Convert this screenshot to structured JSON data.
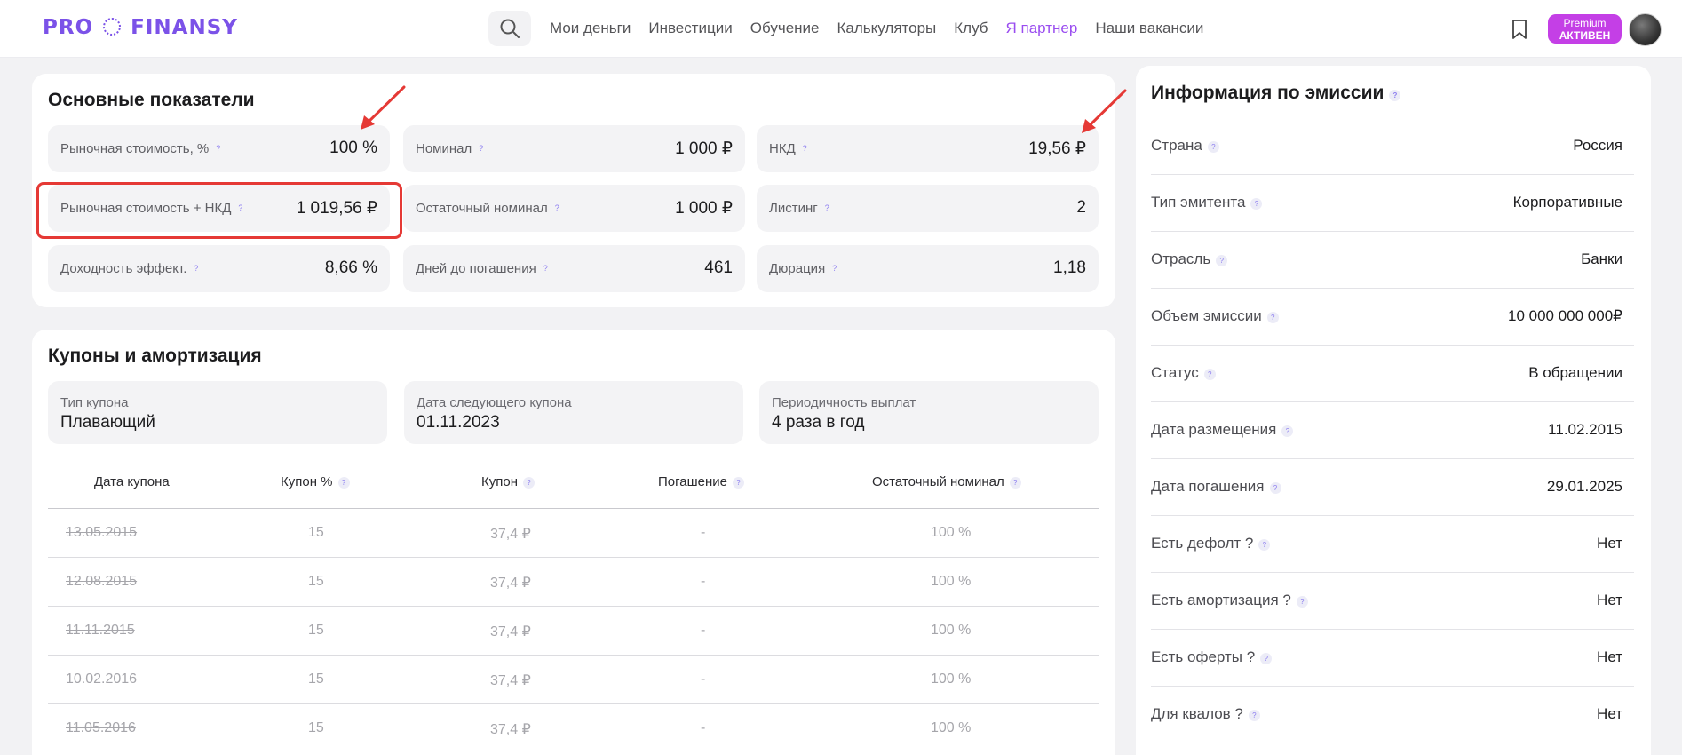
{
  "header": {
    "logo_left": "PRO",
    "logo_right": "FINANSY",
    "nav": [
      "Мои деньги",
      "Инвестиции",
      "Обучение",
      "Калькуляторы",
      "Клуб",
      "Я партнер",
      "Наши вакансии"
    ],
    "premium_line1": "Premium",
    "premium_line2": "АКТИВЕН"
  },
  "icons": {
    "search": "search-icon",
    "bookmark": "bookmark-icon",
    "help": "question-icon"
  },
  "colors": {
    "accent": "#7b52e8",
    "premium": "#c43fe6",
    "highlight": "#e53935",
    "partner": "#9a4df0"
  },
  "main_metrics": {
    "title": "Основные показатели",
    "help": "?",
    "items": [
      {
        "label": "Рыночная стоимость, %",
        "value": "100 %"
      },
      {
        "label": "Номинал",
        "value": "1 000 ₽"
      },
      {
        "label": "НКД",
        "value": "19,56 ₽"
      },
      {
        "label": "Рыночная стоимость + НКД",
        "value": "1 019,56 ₽"
      },
      {
        "label": "Остаточный номинал",
        "value": "1 000 ₽"
      },
      {
        "label": "Листинг",
        "value": "2"
      },
      {
        "label": "Доходность эффект.",
        "value": "8,66 %"
      },
      {
        "label": "Дней до погашения",
        "value": "461"
      },
      {
        "label": "Дюрация",
        "value": "1,18"
      }
    ]
  },
  "coupons": {
    "title": "Купоны и амортизация",
    "info": [
      {
        "label": "Тип купона",
        "value": "Плавающий"
      },
      {
        "label": "Дата следующего купона",
        "value": "01.11.2023"
      },
      {
        "label": "Периодичность выплат",
        "value": "4 раза в год"
      }
    ],
    "columns": [
      "Дата купона",
      "Купон %",
      "Купон",
      "Погашение",
      "Остаточный номинал"
    ],
    "rows": [
      [
        "13.05.2015",
        "15",
        "37,4 ₽",
        "-",
        "100 %"
      ],
      [
        "12.08.2015",
        "15",
        "37,4 ₽",
        "-",
        "100 %"
      ],
      [
        "11.11.2015",
        "15",
        "37,4 ₽",
        "-",
        "100 %"
      ],
      [
        "10.02.2016",
        "15",
        "37,4 ₽",
        "-",
        "100 %"
      ],
      [
        "11.05.2016",
        "15",
        "37,4 ₽",
        "-",
        "100 %"
      ]
    ]
  },
  "emission": {
    "title": "Информация по эмиссии",
    "rows": [
      {
        "label": "Страна",
        "value": "Россия"
      },
      {
        "label": "Тип эмитента",
        "value": "Корпоративные"
      },
      {
        "label": "Отрасль",
        "value": "Банки"
      },
      {
        "label": "Объем эмиссии",
        "value": "10 000 000 000₽"
      },
      {
        "label": "Статус",
        "value": "В обращении"
      },
      {
        "label": "Дата размещения",
        "value": "11.02.2015"
      },
      {
        "label": "Дата погашения",
        "value": "29.01.2025"
      },
      {
        "label": "Есть дефолт ?",
        "value": "Нет"
      },
      {
        "label": "Есть амортизация ?",
        "value": "Нет"
      },
      {
        "label": "Есть оферты ?",
        "value": "Нет"
      },
      {
        "label": "Для квалов ?",
        "value": "Нет"
      }
    ]
  }
}
